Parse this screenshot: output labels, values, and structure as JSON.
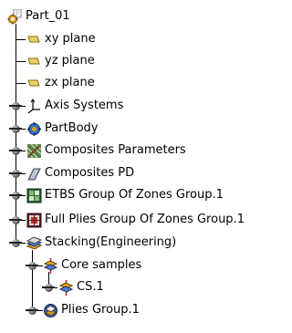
{
  "tree": {
    "root": {
      "label": "Part_01",
      "icon": "part-gear-icon"
    },
    "items": [
      {
        "label": "xy plane",
        "icon": "plane-icon"
      },
      {
        "label": "yz plane",
        "icon": "plane-icon"
      },
      {
        "label": "zx plane",
        "icon": "plane-icon"
      },
      {
        "label": "Axis Systems",
        "icon": "axis-system-icon"
      },
      {
        "label": "PartBody",
        "icon": "partbody-icon"
      },
      {
        "label": "Composites Parameters",
        "icon": "composites-parameters-icon"
      },
      {
        "label": "Composites PD",
        "icon": "composites-pd-icon"
      },
      {
        "label": "ETBS Group Of Zones Group.1",
        "icon": "zones-group-icon"
      },
      {
        "label": "Full Plies Group Of Zones Group.1",
        "icon": "full-plies-group-icon"
      },
      {
        "label": "Stacking(Engineering)",
        "icon": "stacking-icon"
      },
      {
        "label": "Core samples",
        "icon": "core-samples-icon"
      },
      {
        "label": "CS.1",
        "icon": "core-sample-icon"
      },
      {
        "label": "Plies Group.1",
        "icon": "plies-group-icon"
      }
    ]
  }
}
